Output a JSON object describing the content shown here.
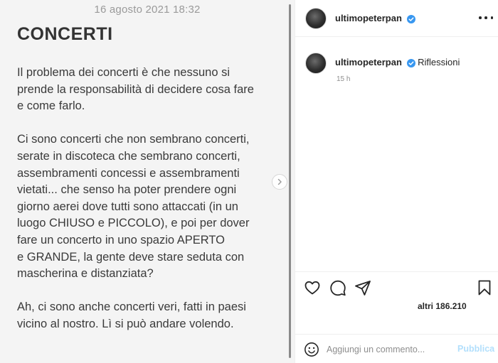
{
  "note": {
    "date": "16 agosto 2021 18:32",
    "title": "CONCERTI",
    "paragraphs": [
      [
        "Il problema dei concerti è che nessuno si",
        "prende la responsabilità di decidere cosa fare",
        "e come farlo."
      ],
      [
        "Ci sono concerti che non sembrano concerti,",
        "serate in discoteca che sembrano concerti,",
        "assembramenti concessi e assembramenti",
        "vietati... che senso ha poter prendere ogni",
        "giorno aerei dove tutti sono attaccati (in un",
        "luogo CHIUSO e PICCOLO), e poi per dover",
        "fare un concerto in uno spazio APERTO",
        "e GRANDE, la gente deve stare seduta con",
        "mascherina e distanziata?"
      ],
      [
        "Ah, ci sono anche concerti veri, fatti in paesi",
        "vicino al nostro. Lì si può andare volendo."
      ]
    ]
  },
  "header": {
    "username": "ultimopeterpan",
    "more_icon": "more-options-icon"
  },
  "caption": {
    "username": "ultimopeterpan",
    "text": "Riflessioni",
    "time": "15 h"
  },
  "actions": {
    "icons": [
      "heart-icon",
      "comment-icon",
      "share-icon",
      "bookmark-icon"
    ],
    "likes": "altri 186.210"
  },
  "comment": {
    "placeholder": "Aggiungi un commento...",
    "publish_label": "Pubblica"
  },
  "colors": {
    "verified": "#3897f0",
    "publish_disabled": "#b2dffc"
  }
}
